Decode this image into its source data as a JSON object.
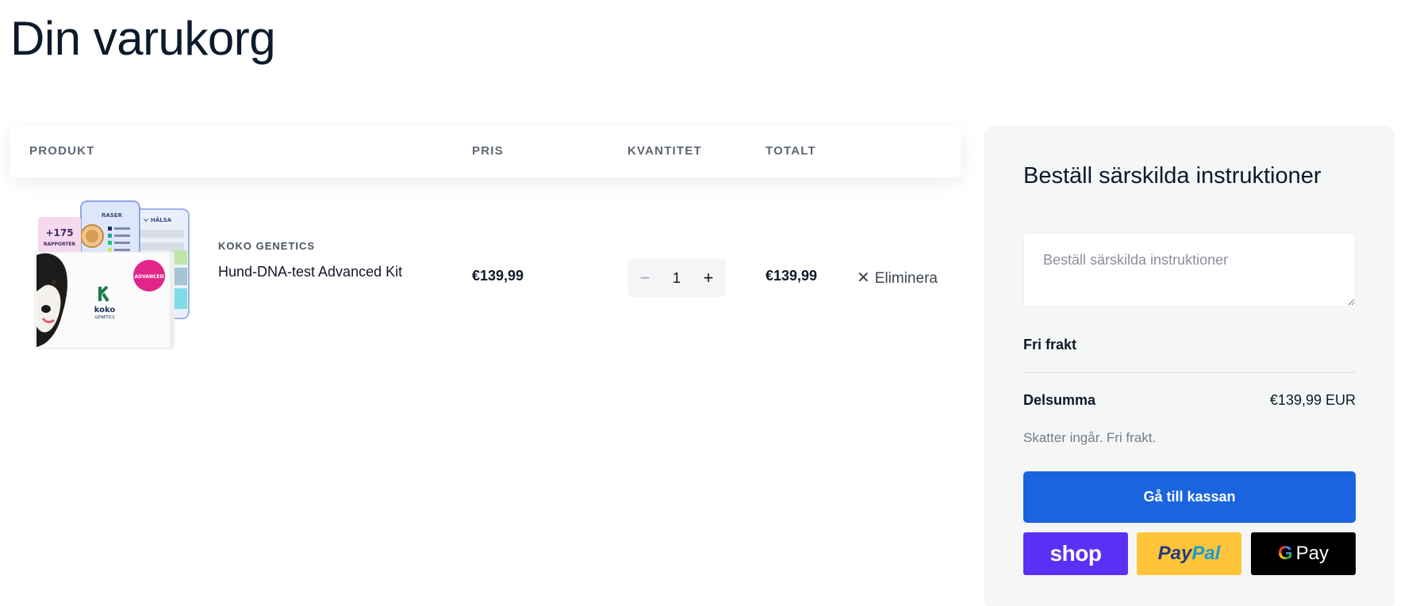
{
  "page": {
    "title": "Din varukorg"
  },
  "table": {
    "headers": {
      "product": "PRODUKT",
      "price": "PRIS",
      "quantity": "KVANTITET",
      "total": "TOTALT"
    }
  },
  "cart_item": {
    "brand": "KOKO GENETICS",
    "name": "Hund-DNA-test Advanced Kit",
    "price": "€139,99",
    "quantity": "1",
    "total": "€139,99",
    "remove_label": "Eliminera",
    "image": {
      "badge_count": "+175",
      "badge_label": "RAPPORTER",
      "screen1_title": "RASER",
      "screen2_title": "HÄLSA",
      "box_label": "ADVANCED",
      "logo": "koko",
      "logo_sub": "GENETICS"
    }
  },
  "summary": {
    "title": "Beställ särskilda instruktioner",
    "notes_placeholder": "Beställ särskilda instruktioner",
    "shipping": "Fri frakt",
    "subtotal_label": "Delsumma",
    "subtotal_value": "€139,99 EUR",
    "tax_note": "Skatter ingår. Fri frakt.",
    "checkout_label": "Gå till kassan",
    "pay_buttons": {
      "shop": "shop",
      "paypal_a": "Pay",
      "paypal_b": "Pal",
      "gpay_g": "G",
      "gpay_text": "Pay"
    }
  },
  "colors": {
    "accent": "#1a64e0",
    "shop": "#5a31f4",
    "paypal": "#ffc439",
    "gpay": "#000000"
  }
}
